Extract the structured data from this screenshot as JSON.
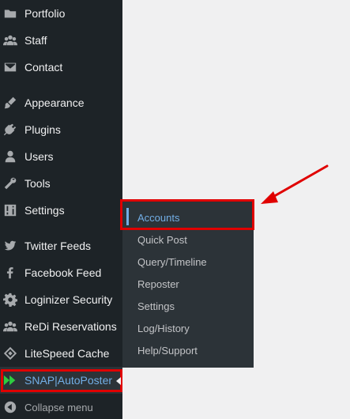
{
  "sidebar": {
    "items": [
      {
        "label": "Portfolio",
        "icon": "folder-icon"
      },
      {
        "label": "Staff",
        "icon": "users-group-icon"
      },
      {
        "label": "Contact",
        "icon": "mail-icon"
      },
      {
        "label": "Appearance",
        "icon": "brush-icon"
      },
      {
        "label": "Plugins",
        "icon": "plug-icon"
      },
      {
        "label": "Users",
        "icon": "user-icon"
      },
      {
        "label": "Tools",
        "icon": "wrench-icon"
      },
      {
        "label": "Settings",
        "icon": "sliders-icon"
      },
      {
        "label": "Twitter Feeds",
        "icon": "twitter-icon"
      },
      {
        "label": "Facebook Feed",
        "icon": "facebook-icon"
      },
      {
        "label": "Loginizer Security",
        "icon": "gear-icon"
      },
      {
        "label": "ReDi Reservations",
        "icon": "users-group-icon"
      },
      {
        "label": "LiteSpeed Cache",
        "icon": "diamond-icon"
      },
      {
        "label": "SNAP|AutoPoster",
        "icon": "snap-arrows-icon",
        "active": true
      }
    ],
    "collapse_label": "Collapse menu"
  },
  "submenu": {
    "items": [
      {
        "label": "Accounts",
        "active": true
      },
      {
        "label": "Quick Post"
      },
      {
        "label": "Query/Timeline"
      },
      {
        "label": "Reposter"
      },
      {
        "label": "Settings"
      },
      {
        "label": "Log/History"
      },
      {
        "label": "Help/Support"
      }
    ]
  },
  "colors": {
    "sidebar_bg": "#1d2327",
    "submenu_bg": "#2c3338",
    "accent": "#72aee6",
    "highlight": "#e00000",
    "snap_icon": "#2ecc40"
  }
}
